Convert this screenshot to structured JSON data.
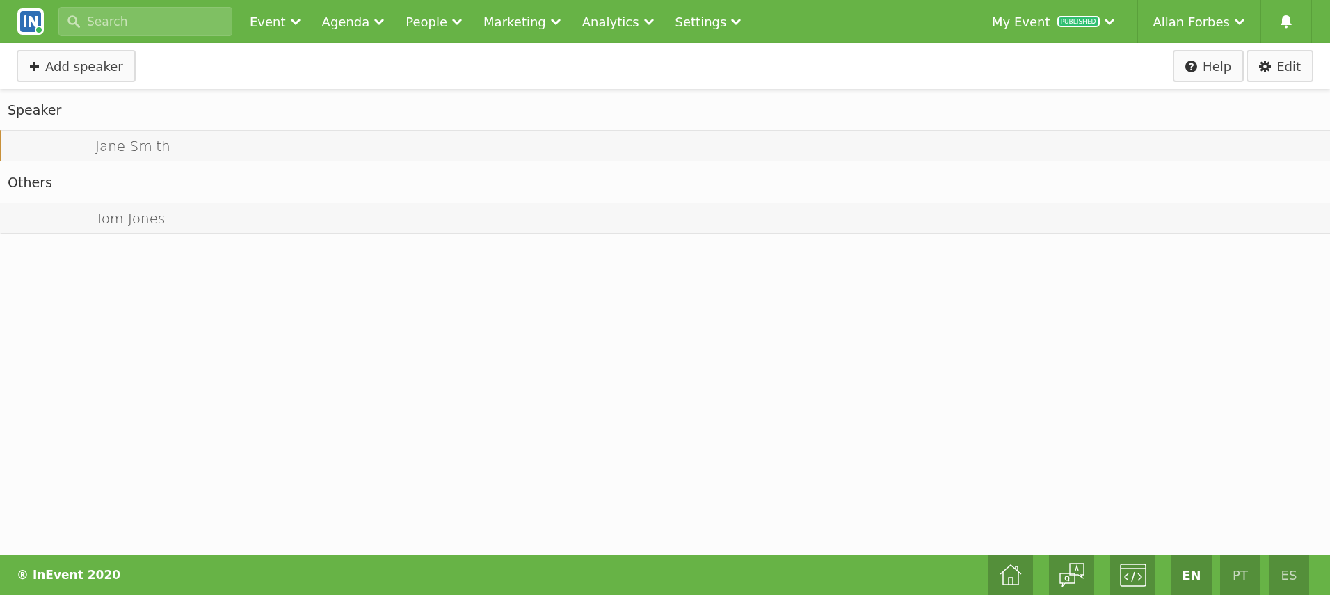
{
  "topbar": {
    "search": {
      "placeholder": "Search"
    },
    "nav": [
      {
        "label": "Event"
      },
      {
        "label": "Agenda"
      },
      {
        "label": "People"
      },
      {
        "label": "Marketing"
      },
      {
        "label": "Analytics"
      },
      {
        "label": "Settings"
      }
    ],
    "event": {
      "label": "My Event",
      "badge": "PUBLISHED"
    },
    "user": {
      "label": "Allan Forbes"
    }
  },
  "toolbar": {
    "add_button": "Add speaker",
    "help_button": "Help",
    "edit_button": "Edit"
  },
  "groups": [
    {
      "title": "Speaker",
      "rows": [
        {
          "name": "Jane Smith",
          "selected": true
        }
      ]
    },
    {
      "title": "Others",
      "rows": [
        {
          "name": "Tom Jones",
          "selected": false
        }
      ]
    }
  ],
  "footer": {
    "copyright": "® InEvent 2020",
    "languages": [
      {
        "label": "EN",
        "selected": true
      },
      {
        "label": "PT",
        "selected": false
      },
      {
        "label": "ES",
        "selected": false
      }
    ]
  }
}
